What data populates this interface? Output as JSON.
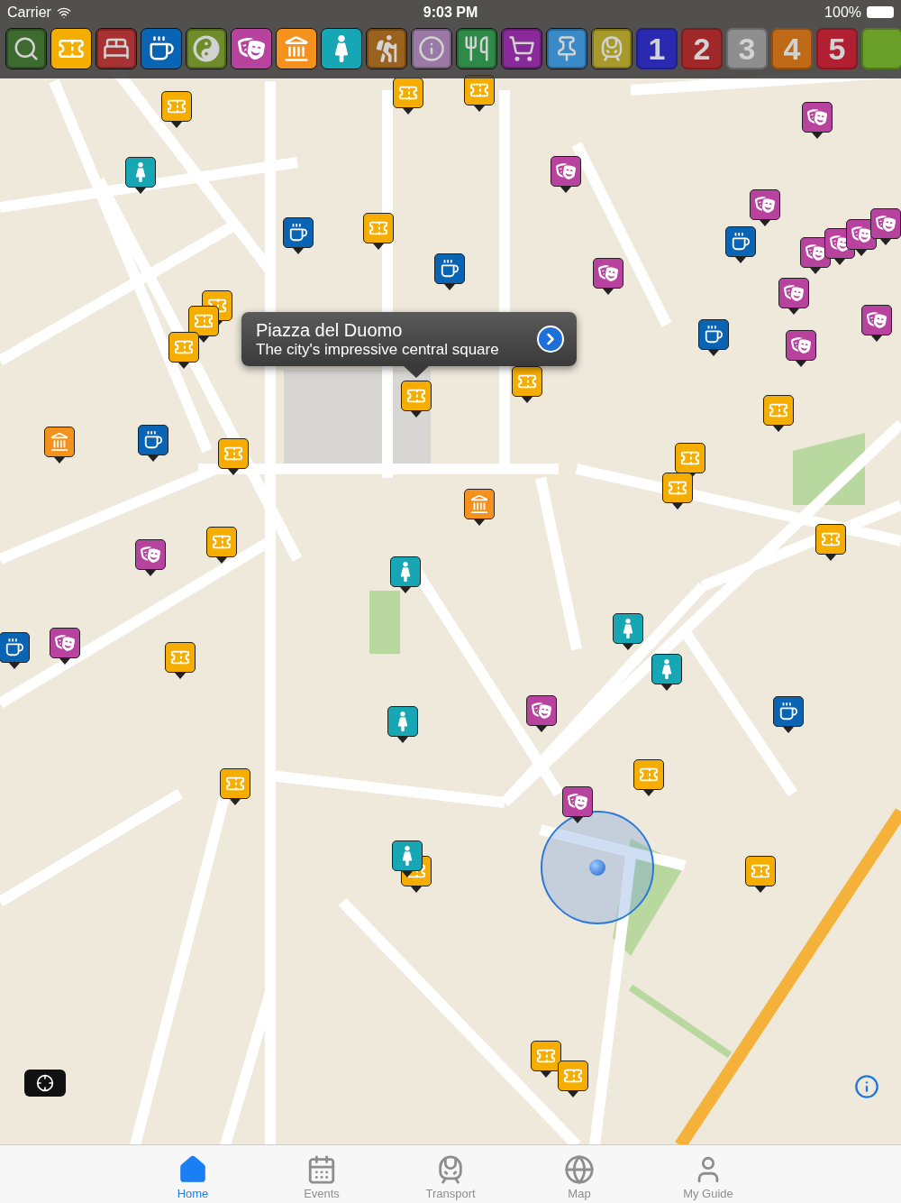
{
  "status_bar": {
    "carrier": "Carrier",
    "time": "9:03 PM",
    "battery": "100%"
  },
  "categories": [
    {
      "kind": "search",
      "color": "#3d6b2f",
      "on": false
    },
    {
      "kind": "events",
      "color": "#f5ad00",
      "on": true
    },
    {
      "kind": "hotel",
      "color": "#a83232",
      "on": false
    },
    {
      "kind": "coffee",
      "color": "#0a64b4",
      "on": true
    },
    {
      "kind": "wellness",
      "color": "#6e8c2a",
      "on": false
    },
    {
      "kind": "theatre",
      "color": "#b8439e",
      "on": true
    },
    {
      "kind": "museum",
      "color": "#f5921e",
      "on": true
    },
    {
      "kind": "nightlife",
      "color": "#16a6b4",
      "on": true
    },
    {
      "kind": "hiking",
      "color": "#9a621e",
      "on": false
    },
    {
      "kind": "info",
      "color": "#9a7aa5",
      "on": false
    },
    {
      "kind": "restaurant",
      "color": "#2f8a4a",
      "on": false
    },
    {
      "kind": "shopping",
      "color": "#8a2a9a",
      "on": false
    },
    {
      "kind": "pin",
      "color": "#3a8ac8",
      "on": false
    },
    {
      "kind": "train",
      "color": "#a89a2a",
      "on": false
    },
    {
      "kind": "number",
      "label": "1",
      "color": "#2a2ab0",
      "on": false
    },
    {
      "kind": "number",
      "label": "2",
      "color": "#a02828",
      "on": false
    },
    {
      "kind": "number",
      "label": "3",
      "color": "#8e8e8e",
      "on": false
    },
    {
      "kind": "number",
      "label": "4",
      "color": "#c06a18",
      "on": false
    },
    {
      "kind": "number",
      "label": "5",
      "color": "#b02030",
      "on": false
    },
    {
      "kind": "number",
      "color": "#6aa02a",
      "on": false
    }
  ],
  "markers": [
    {
      "kind": "events"
    },
    {
      "kind": "events"
    },
    {
      "kind": "events"
    },
    {
      "kind": "events"
    },
    {
      "kind": "events"
    },
    {
      "kind": "events"
    },
    {
      "kind": "events"
    },
    {
      "kind": "events"
    },
    {
      "kind": "events"
    },
    {
      "kind": "events"
    },
    {
      "kind": "events"
    },
    {
      "kind": "events"
    },
    {
      "kind": "events"
    },
    {
      "kind": "events"
    },
    {
      "kind": "events"
    },
    {
      "kind": "events"
    },
    {
      "kind": "events"
    },
    {
      "kind": "events"
    },
    {
      "kind": "events"
    },
    {
      "kind": "events"
    },
    {
      "kind": "events"
    },
    {
      "kind": "events"
    },
    {
      "kind": "coffee"
    },
    {
      "kind": "coffee"
    },
    {
      "kind": "coffee"
    },
    {
      "kind": "coffee"
    },
    {
      "kind": "coffee"
    },
    {
      "kind": "coffee"
    },
    {
      "kind": "coffee"
    },
    {
      "kind": "theatre"
    },
    {
      "kind": "theatre"
    },
    {
      "kind": "theatre"
    },
    {
      "kind": "theatre"
    },
    {
      "kind": "theatre"
    },
    {
      "kind": "theatre"
    },
    {
      "kind": "theatre"
    },
    {
      "kind": "theatre"
    },
    {
      "kind": "theatre"
    },
    {
      "kind": "theatre"
    },
    {
      "kind": "theatre"
    },
    {
      "kind": "theatre"
    },
    {
      "kind": "theatre"
    },
    {
      "kind": "theatre"
    },
    {
      "kind": "theatre"
    },
    {
      "kind": "museum"
    },
    {
      "kind": "museum"
    },
    {
      "kind": "nightlife"
    },
    {
      "kind": "nightlife"
    },
    {
      "kind": "nightlife"
    },
    {
      "kind": "nightlife"
    },
    {
      "kind": "nightlife"
    },
    {
      "kind": "nightlife"
    }
  ],
  "callout": {
    "title": "Piazza del Duomo",
    "subtitle": "The city's impressive central square"
  },
  "tabs": [
    {
      "kind": "home",
      "label": "Home",
      "selected": true
    },
    {
      "kind": "events",
      "label": "Events",
      "selected": false
    },
    {
      "kind": "transport",
      "label": "Transport",
      "selected": false
    },
    {
      "kind": "map",
      "label": "Map",
      "selected": false
    },
    {
      "kind": "guide",
      "label": "My Guide",
      "selected": false
    }
  ]
}
